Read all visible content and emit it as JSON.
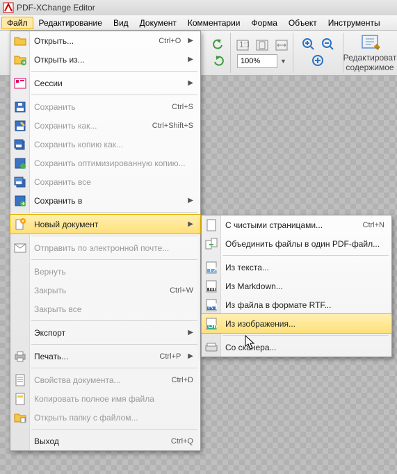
{
  "app": {
    "title": "PDF-XChange Editor"
  },
  "menubar": {
    "items": [
      {
        "label": "Файл",
        "active": true
      },
      {
        "label": "Редактирование"
      },
      {
        "label": "Вид"
      },
      {
        "label": "Документ"
      },
      {
        "label": "Комментарии"
      },
      {
        "label": "Форма"
      },
      {
        "label": "Объект"
      },
      {
        "label": "Инструменты"
      }
    ]
  },
  "toolbar": {
    "zoom": "100%",
    "edit_content_line1": "Редактироват",
    "edit_content_line2": "содержимое"
  },
  "file_menu": {
    "open": {
      "label": "Открыть...",
      "shortcut": "Ctrl+O"
    },
    "open_from": {
      "label": "Открыть из..."
    },
    "sessions": {
      "label": "Сессии"
    },
    "save": {
      "label": "Сохранить",
      "shortcut": "Ctrl+S"
    },
    "save_as": {
      "label": "Сохранить как...",
      "shortcut": "Ctrl+Shift+S"
    },
    "save_copy": {
      "label": "Сохранить копию как..."
    },
    "save_opt": {
      "label": "Сохранить оптимизированную копию..."
    },
    "save_all": {
      "label": "Сохранить все"
    },
    "save_to": {
      "label": "Сохранить в"
    },
    "new_doc": {
      "label": "Новый документ"
    },
    "send_mail": {
      "label": "Отправить по электронной почте..."
    },
    "revert": {
      "label": "Вернуть"
    },
    "close": {
      "label": "Закрыть",
      "shortcut": "Ctrl+W"
    },
    "close_all": {
      "label": "Закрыть все"
    },
    "export": {
      "label": "Экспорт"
    },
    "print": {
      "label": "Печать...",
      "shortcut": "Ctrl+P"
    },
    "doc_props": {
      "label": "Свойства документа...",
      "shortcut": "Ctrl+D"
    },
    "copy_name": {
      "label": "Копировать полное имя файла"
    },
    "open_folder": {
      "label": "Открыть папку с файлом..."
    },
    "exit": {
      "label": "Выход",
      "shortcut": "Ctrl+Q"
    }
  },
  "submenu": {
    "blank": {
      "label": "С чистыми страницами...",
      "shortcut": "Ctrl+N"
    },
    "combine": {
      "label": "Объединить файлы в один PDF-файл..."
    },
    "from_text": {
      "label": "Из текста..."
    },
    "from_md": {
      "label": "Из Markdown..."
    },
    "from_rtf": {
      "label": "Из файла в формате RTF..."
    },
    "from_image": {
      "label": "Из изображения..."
    },
    "from_scanner": {
      "label": "Со сканера..."
    }
  }
}
